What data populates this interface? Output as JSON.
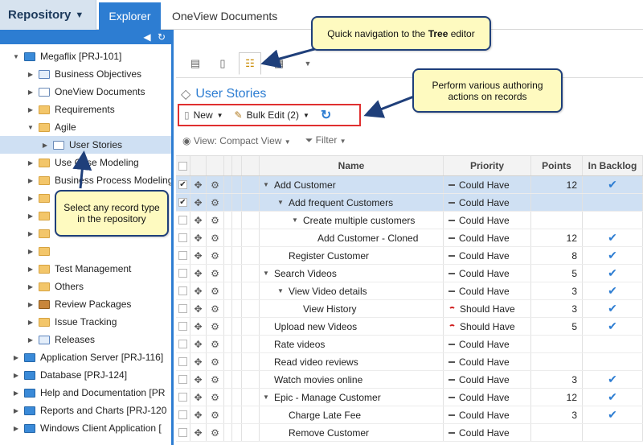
{
  "topbar": {
    "repository_label": "Repository",
    "explorer_tab": "Explorer",
    "oneview_tab": "OneView Documents"
  },
  "tree": [
    {
      "label": "Megaflix [PRJ-101]",
      "level": 0,
      "toggle": "▼",
      "icon": "blue"
    },
    {
      "label": "Business Objectives",
      "level": 1,
      "toggle": "▶",
      "icon": "list"
    },
    {
      "label": "OneView Documents",
      "level": 1,
      "toggle": "▶",
      "icon": "doc"
    },
    {
      "label": "Requirements",
      "level": 1,
      "toggle": "▶",
      "icon": "folder"
    },
    {
      "label": "Agile",
      "level": 1,
      "toggle": "▼",
      "icon": "folder"
    },
    {
      "label": "User Stories",
      "level": 2,
      "toggle": "▶",
      "icon": "doc",
      "selected": true
    },
    {
      "label": "Use Case Modeling",
      "level": 1,
      "toggle": "▶",
      "icon": "folder"
    },
    {
      "label": "Business Process Modeling",
      "level": 1,
      "toggle": "▶",
      "icon": "folder"
    },
    {
      "label": "",
      "level": 1,
      "toggle": "▶",
      "icon": "folder"
    },
    {
      "label": "",
      "level": 1,
      "toggle": "▶",
      "icon": "folder"
    },
    {
      "label": "",
      "level": 1,
      "toggle": "▶",
      "icon": "folder"
    },
    {
      "label": "",
      "level": 1,
      "toggle": "▶",
      "icon": "folder"
    },
    {
      "label": "Test Management",
      "level": 1,
      "toggle": "▶",
      "icon": "folder"
    },
    {
      "label": "Others",
      "level": 1,
      "toggle": "▶",
      "icon": "folder"
    },
    {
      "label": "Review Packages",
      "level": 1,
      "toggle": "▶",
      "icon": "brown"
    },
    {
      "label": "Issue Tracking",
      "level": 1,
      "toggle": "▶",
      "icon": "folder"
    },
    {
      "label": "Releases",
      "level": 1,
      "toggle": "▶",
      "icon": "list"
    },
    {
      "label": "Application Server [PRJ-116]",
      "level": 0,
      "toggle": "▶",
      "icon": "blue"
    },
    {
      "label": "Database [PRJ-124]",
      "level": 0,
      "toggle": "▶",
      "icon": "blue"
    },
    {
      "label": "Help and Documentation [PR",
      "level": 0,
      "toggle": "▶",
      "icon": "blue"
    },
    {
      "label": "Reports and Charts [PRJ-120",
      "level": 0,
      "toggle": "▶",
      "icon": "blue"
    },
    {
      "label": "Windows Client Application [",
      "level": 0,
      "toggle": "▶",
      "icon": "blue"
    }
  ],
  "main": {
    "title": "User Stories",
    "new_label": "New",
    "bulk_edit_label": "Bulk Edit (2)",
    "view_label": "View: Compact View",
    "filter_label": "Filter"
  },
  "grid": {
    "headers": {
      "name": "Name",
      "priority": "Priority",
      "points": "Points",
      "backlog": "In Backlog"
    },
    "rows": [
      {
        "name": "Add Customer",
        "indent": 0,
        "toggle": "▼",
        "priority": "Could Have",
        "high": false,
        "points": "12",
        "backlog": true,
        "checked": true,
        "selected": true
      },
      {
        "name": "Add frequent Customers",
        "indent": 1,
        "toggle": "▼",
        "priority": "Could Have",
        "high": false,
        "points": "",
        "backlog": false,
        "checked": true,
        "selected": true
      },
      {
        "name": "Create multiple customers",
        "indent": 2,
        "toggle": "▼",
        "priority": "Could Have",
        "high": false,
        "points": "",
        "backlog": false,
        "checked": false,
        "selected": false
      },
      {
        "name": "Add Customer - Cloned",
        "indent": 3,
        "toggle": "",
        "priority": "Could Have",
        "high": false,
        "points": "12",
        "backlog": true,
        "checked": false,
        "selected": false
      },
      {
        "name": "Register Customer",
        "indent": 1,
        "toggle": "",
        "priority": "Could Have",
        "high": false,
        "points": "8",
        "backlog": true,
        "checked": false,
        "selected": false
      },
      {
        "name": "Search Videos",
        "indent": 0,
        "toggle": "▼",
        "priority": "Could Have",
        "high": false,
        "points": "5",
        "backlog": true,
        "checked": false,
        "selected": false
      },
      {
        "name": "View Video details",
        "indent": 1,
        "toggle": "▼",
        "priority": "Could Have",
        "high": false,
        "points": "3",
        "backlog": true,
        "checked": false,
        "selected": false
      },
      {
        "name": "View History",
        "indent": 2,
        "toggle": "",
        "priority": "Should Have",
        "high": true,
        "points": "3",
        "backlog": true,
        "checked": false,
        "selected": false
      },
      {
        "name": "Upload new Videos",
        "indent": 0,
        "toggle": "",
        "priority": "Should Have",
        "high": true,
        "points": "5",
        "backlog": true,
        "checked": false,
        "selected": false
      },
      {
        "name": "Rate videos",
        "indent": 0,
        "toggle": "",
        "priority": "Could Have",
        "high": false,
        "points": "",
        "backlog": false,
        "checked": false,
        "selected": false
      },
      {
        "name": "Read video reviews",
        "indent": 0,
        "toggle": "",
        "priority": "Could Have",
        "high": false,
        "points": "",
        "backlog": false,
        "checked": false,
        "selected": false
      },
      {
        "name": "Watch movies online",
        "indent": 0,
        "toggle": "",
        "priority": "Could Have",
        "high": false,
        "points": "3",
        "backlog": true,
        "checked": false,
        "selected": false
      },
      {
        "name": "Epic - Manage Customer",
        "indent": 0,
        "toggle": "▼",
        "priority": "Could Have",
        "high": false,
        "points": "12",
        "backlog": true,
        "checked": false,
        "selected": false
      },
      {
        "name": "Charge Late Fee",
        "indent": 1,
        "toggle": "",
        "priority": "Could Have",
        "high": false,
        "points": "3",
        "backlog": true,
        "checked": false,
        "selected": false
      },
      {
        "name": "Remove Customer",
        "indent": 1,
        "toggle": "",
        "priority": "Could Have",
        "high": false,
        "points": "",
        "backlog": false,
        "checked": false,
        "selected": false
      }
    ]
  },
  "callouts": {
    "tree_editor_prefix": "Quick navigation to the ",
    "tree_editor_bold": "Tree",
    "tree_editor_suffix": " editor",
    "authoring": "Perform various authoring actions on records",
    "record_type": "Select any record type in the repository"
  }
}
